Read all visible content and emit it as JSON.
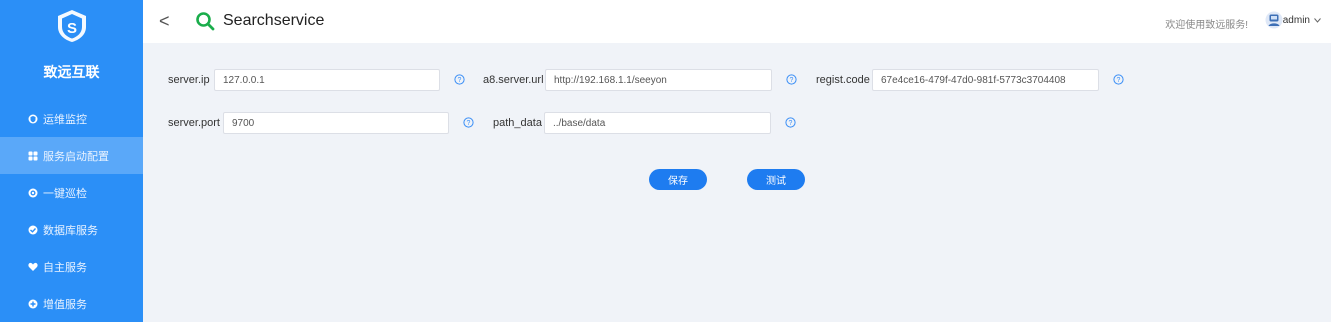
{
  "sidebar": {
    "brand": "致远互联",
    "items": [
      {
        "label": "运维监控",
        "icon": "shield-icon"
      },
      {
        "label": "服务启动配置",
        "icon": "grid-icon"
      },
      {
        "label": "一键巡检",
        "icon": "target-icon"
      },
      {
        "label": "数据库服务",
        "icon": "database-icon"
      },
      {
        "label": "自主服务",
        "icon": "heart-icon"
      },
      {
        "label": "增值服务",
        "icon": "plus-icon"
      }
    ],
    "active_index": 1,
    "color": "#2b8ff7"
  },
  "header": {
    "back": "<",
    "title": "Searchservice",
    "welcome": "欢迎使用致远服务!",
    "user": "admin"
  },
  "form": {
    "server_ip": {
      "label": "server.ip",
      "value": "127.0.0.1"
    },
    "a8_server_url": {
      "label": "a8.server.url",
      "value": "http://192.168.1.1/seeyon"
    },
    "regist_code": {
      "label": "regist.code",
      "value": "67e4ce16-479f-47d0-981f-5773c3704408"
    },
    "server_port": {
      "label": "server.port",
      "value": "9700"
    },
    "path_data": {
      "label": "path_data",
      "value": "../base/data"
    }
  },
  "buttons": {
    "save": "保存",
    "test": "测试"
  }
}
